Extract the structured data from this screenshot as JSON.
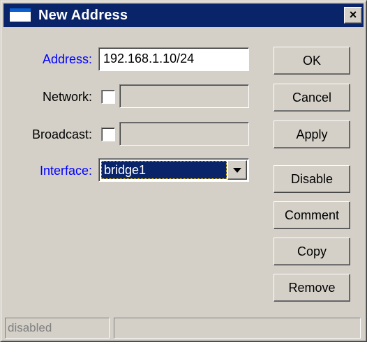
{
  "window": {
    "title": "New Address",
    "close_symbol": "×"
  },
  "form": {
    "address": {
      "label": "Address:",
      "value": "192.168.1.10/24"
    },
    "network": {
      "label": "Network:",
      "checked": false,
      "value": ""
    },
    "broadcast": {
      "label": "Broadcast:",
      "checked": false,
      "value": ""
    },
    "interface": {
      "label": "Interface:",
      "selected": "bridge1"
    }
  },
  "buttons": {
    "ok": "OK",
    "cancel": "Cancel",
    "apply": "Apply",
    "disable": "Disable",
    "comment": "Comment",
    "copy": "Copy",
    "remove": "Remove"
  },
  "statusbar": {
    "status": "disabled",
    "info": ""
  },
  "colors": {
    "title_bar": "#0a246a",
    "window_bg": "#d4d0c8",
    "required_label": "#0000ff"
  }
}
